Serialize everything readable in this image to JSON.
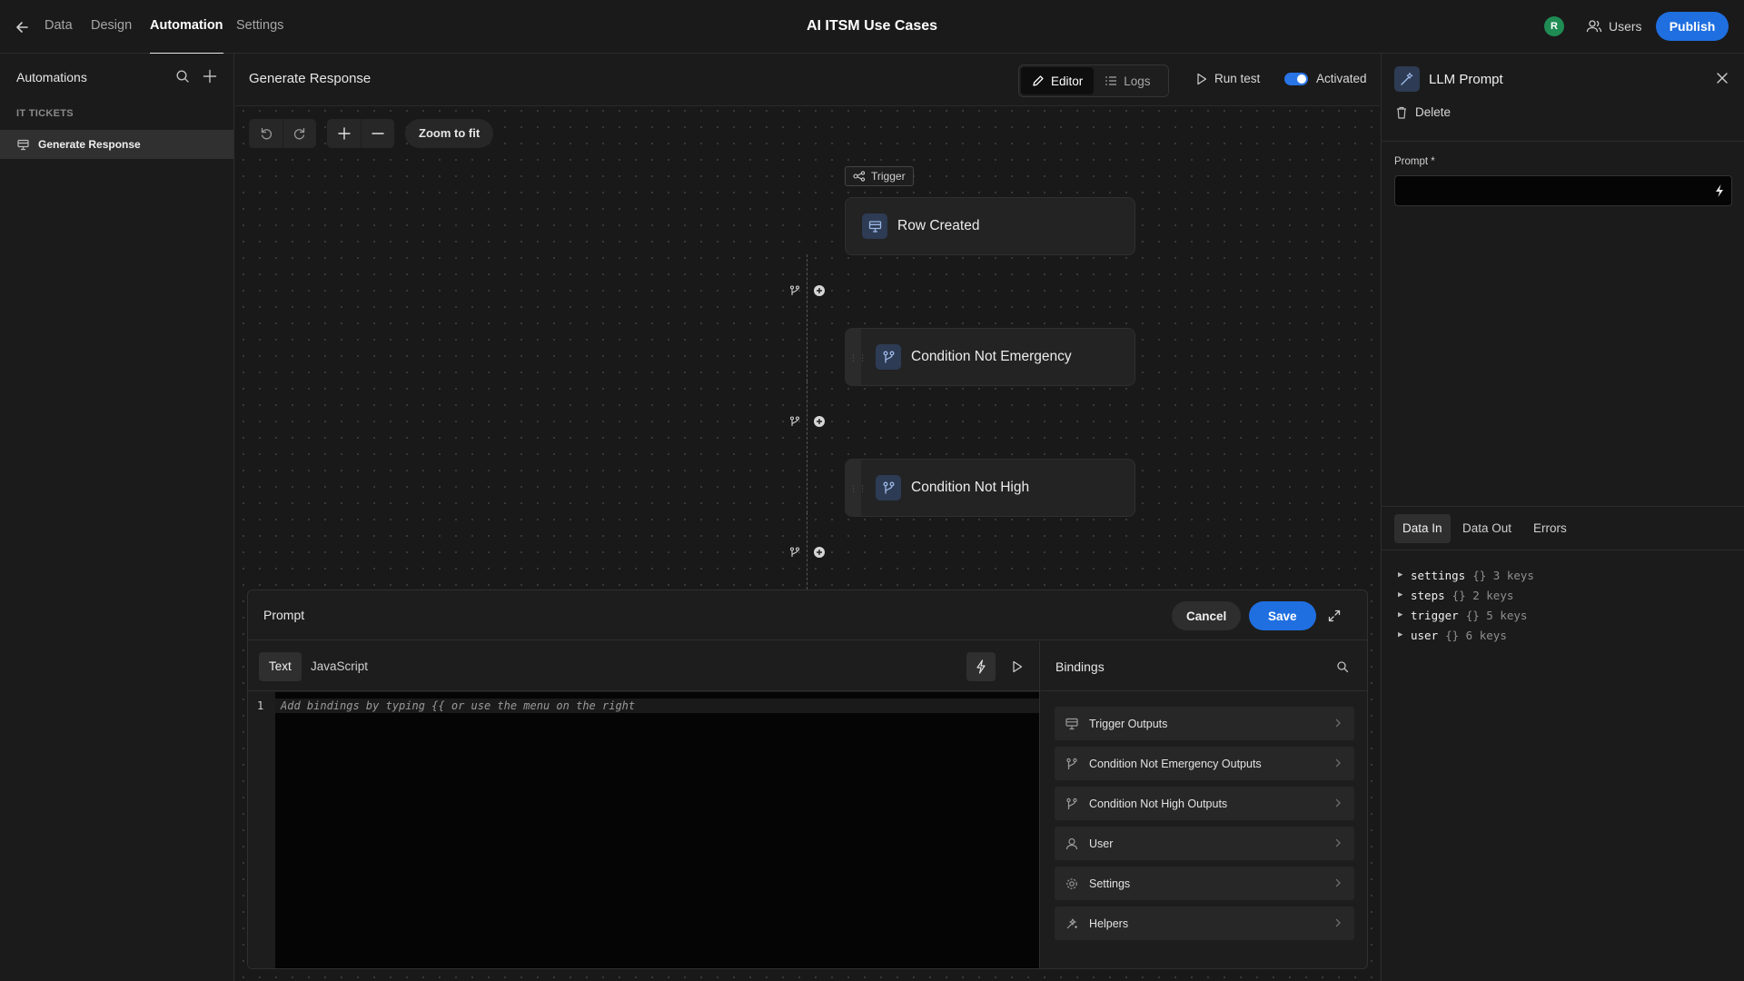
{
  "topbar": {
    "nav": [
      "Data",
      "Design",
      "Automation",
      "Settings"
    ],
    "active_nav": "Automation",
    "app_title": "AI ITSM Use Cases",
    "avatar_initial": "R",
    "users_label": "Users",
    "publish_label": "Publish"
  },
  "sidebar": {
    "title": "Automations",
    "section": "IT TICKETS",
    "items": [
      {
        "label": "Generate Response"
      }
    ]
  },
  "main": {
    "automation_name": "Generate Response",
    "editor_label": "Editor",
    "logs_label": "Logs",
    "run_test_label": "Run test",
    "activated_label": "Activated",
    "activated": true,
    "zoom_fit_label": "Zoom to fit",
    "trigger_tag": "Trigger",
    "nodes": [
      {
        "label": "Row Created",
        "icon": "table-row-icon"
      },
      {
        "label": "Condition Not Emergency",
        "icon": "branch-icon"
      },
      {
        "label": "Condition Not High",
        "icon": "branch-icon"
      }
    ]
  },
  "drawer": {
    "title": "Prompt",
    "cancel_label": "Cancel",
    "save_label": "Save",
    "tabs": [
      "Text",
      "JavaScript"
    ],
    "active_tab": "Text",
    "line_number": "1",
    "placeholder": "Add bindings by typing {{ or use the menu on the right",
    "bindings_title": "Bindings",
    "bindings": [
      {
        "label": "Trigger Outputs",
        "icon": "table-row-icon"
      },
      {
        "label": "Condition Not Emergency Outputs",
        "icon": "branch-icon"
      },
      {
        "label": "Condition Not High Outputs",
        "icon": "branch-icon"
      },
      {
        "label": "User",
        "icon": "user-icon"
      },
      {
        "label": "Settings",
        "icon": "gear-icon"
      },
      {
        "label": "Helpers",
        "icon": "helpers-icon"
      }
    ]
  },
  "right_panel": {
    "title": "LLM Prompt",
    "delete_label": "Delete",
    "prompt_label": "Prompt *",
    "tabs": [
      "Data In",
      "Data Out",
      "Errors"
    ],
    "active_tab": "Data In",
    "tree": [
      {
        "key": "settings",
        "meta": "{} 3 keys"
      },
      {
        "key": "steps",
        "meta": "{} 2 keys"
      },
      {
        "key": "trigger",
        "meta": "{} 5 keys"
      },
      {
        "key": "user",
        "meta": "{} 6 keys"
      }
    ]
  },
  "colors": {
    "accent": "#1f6fe0",
    "avatar": "#1f8c54",
    "node_icon_bg": "#2d3b54"
  }
}
